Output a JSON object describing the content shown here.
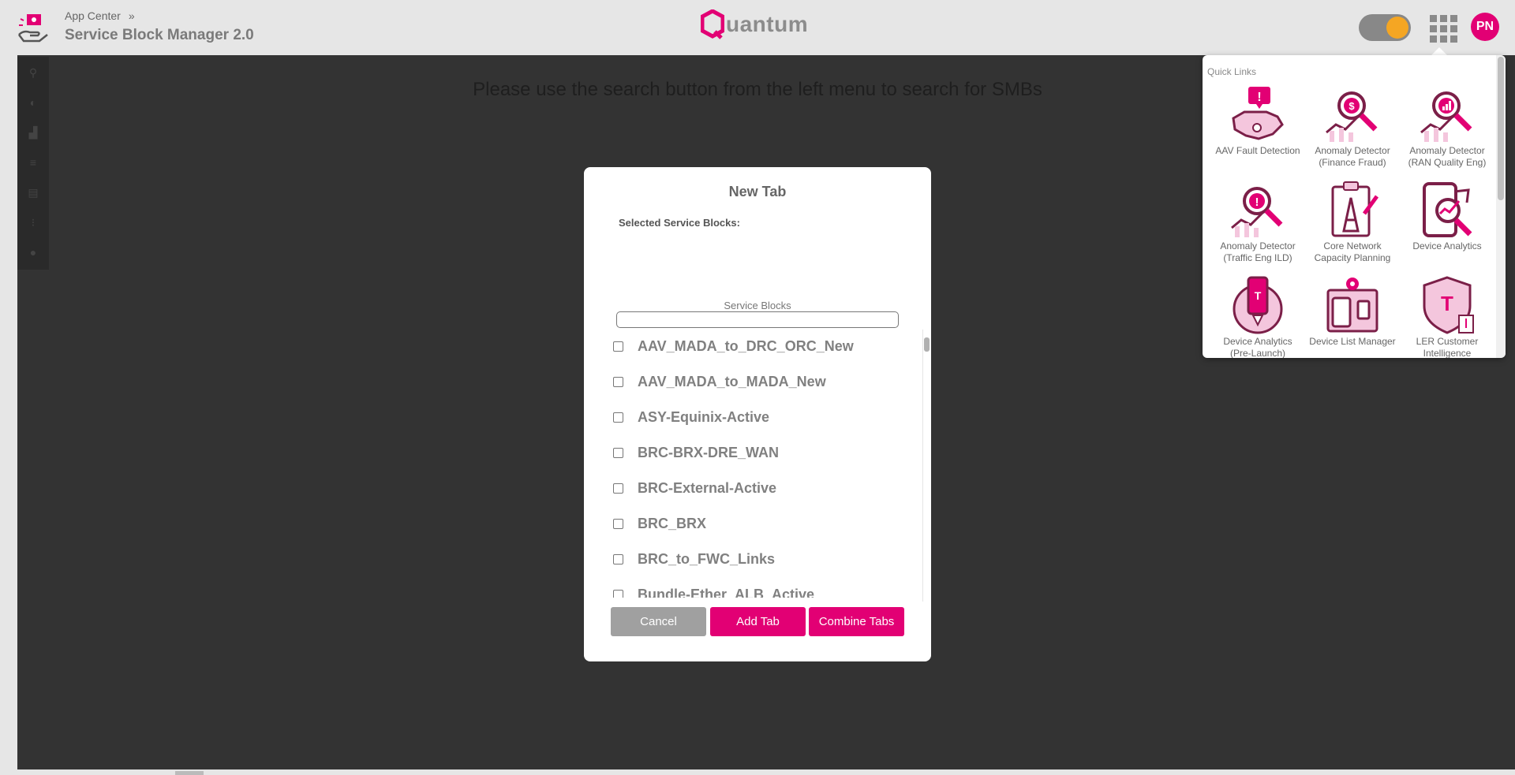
{
  "header": {
    "breadcrumb": "App Center",
    "breadcrumb_sep_icon": "double-chevron-right-icon",
    "title": "Service Block Manager 2.0",
    "brand": "uantum",
    "avatar_initials": "PN",
    "accent_color": "#e20074"
  },
  "main": {
    "hint": "Please use the search button from the left menu to search for SMBs",
    "rail_icons": [
      "search-icon",
      "toggle-icon",
      "chart-icon",
      "database-icon",
      "clipboard-icon",
      "dashboard-icon",
      "user-settings-icon"
    ]
  },
  "dialog": {
    "title": "New Tab",
    "selected_label": "Selected Service Blocks:",
    "service_blocks_label": "Service Blocks",
    "search_value": "",
    "items": [
      "AAV_MADA_to_DRC_ORC_New",
      "AAV_MADA_to_MADA_New",
      "ASY-Equinix-Active",
      "BRC-BRX-DRE_WAN",
      "BRC-External-Active",
      "BRC_BRX",
      "BRC_to_FWC_Links",
      "Bundle-Ether_ALB_Active"
    ],
    "buttons": {
      "cancel": "Cancel",
      "add": "Add Tab",
      "combine": "Combine Tabs"
    }
  },
  "quick_links": {
    "heading": "Quick Links",
    "items": [
      {
        "label": "AAV Fault Detection",
        "icon": "us-map-alert-icon"
      },
      {
        "label": "Anomaly Detector (Finance Fraud)",
        "icon": "magnifier-dollar-icon"
      },
      {
        "label": "Anomaly Detector (RAN Quality Eng)",
        "icon": "magnifier-signal-icon"
      },
      {
        "label": "Anomaly Detector (Traffic Eng ILD)",
        "icon": "magnifier-alert-icon"
      },
      {
        "label": "Core Network Capacity Planning",
        "icon": "clipboard-tower-icon"
      },
      {
        "label": "Device Analytics",
        "icon": "phone-trend-icon"
      },
      {
        "label": "Device Analytics (Pre-Launch)",
        "icon": "phone-launch-icon"
      },
      {
        "label": "Device List Manager",
        "icon": "devices-gear-icon"
      },
      {
        "label": "LER Customer Intelligence",
        "icon": "shield-t-icon"
      }
    ]
  }
}
